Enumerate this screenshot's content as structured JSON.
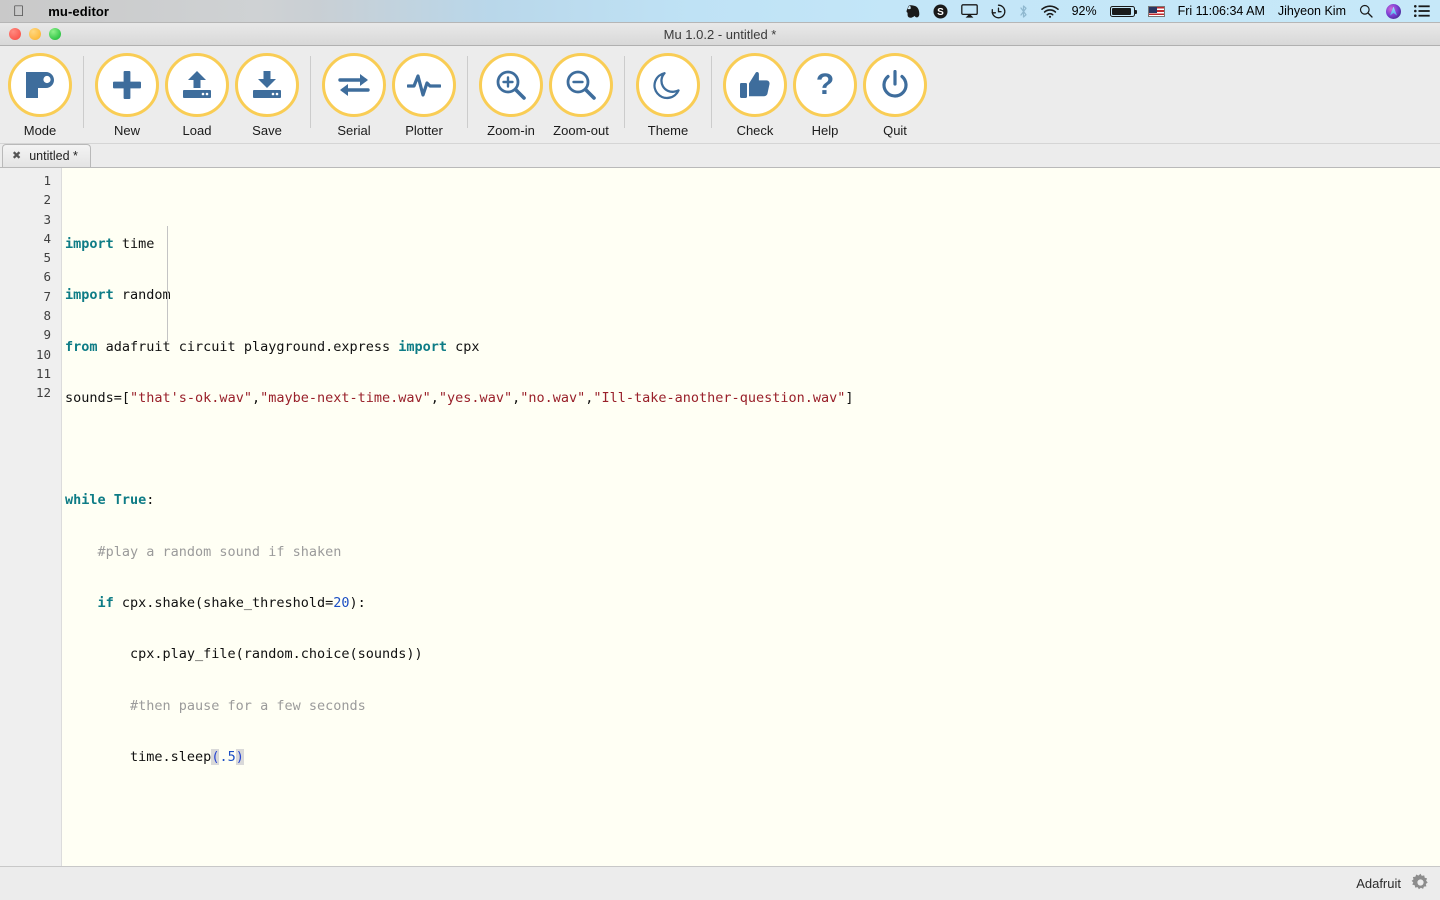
{
  "menubar": {
    "apple_icon": "apple-logo-icon",
    "app_name": "mu-editor",
    "status_items": [
      {
        "name": "evernote-icon",
        "label": ""
      },
      {
        "name": "skype-icon",
        "label": ""
      },
      {
        "name": "airplay-icon",
        "label": ""
      },
      {
        "name": "time-machine-icon",
        "label": ""
      },
      {
        "name": "bluetooth-icon",
        "label": ""
      },
      {
        "name": "wifi-icon",
        "label": ""
      }
    ],
    "battery_percent": "92%",
    "input_source": "us-flag-icon",
    "clock": "Fri 11:06:34 AM",
    "user_name": "Jihyeon Kim",
    "search_icon": "search-icon",
    "siri_icon": "siri-icon",
    "control_center_icon": "list-icon"
  },
  "window": {
    "title": "Mu 1.0.2 - untitled *",
    "traffic_lights": [
      "close-button",
      "minimize-button",
      "zoom-button"
    ],
    "colors": {
      "toolbar_accent": "#f9cd55",
      "icon_blue": "#3e6d9c",
      "editor_background": "#fffff4",
      "gutter_background": "#efefef"
    }
  },
  "toolbar": {
    "buttons": [
      {
        "label": "Mode",
        "icon": "mode-icon"
      },
      {
        "label": "New",
        "icon": "plus-icon"
      },
      {
        "label": "Load",
        "icon": "upload-icon"
      },
      {
        "label": "Save",
        "icon": "download-icon"
      },
      {
        "label": "Serial",
        "icon": "exchange-arrows-icon"
      },
      {
        "label": "Plotter",
        "icon": "waveform-icon"
      },
      {
        "label": "Zoom-in",
        "icon": "magnifier-plus-icon"
      },
      {
        "label": "Zoom-out",
        "icon": "magnifier-minus-icon"
      },
      {
        "label": "Theme",
        "icon": "moon-icon"
      },
      {
        "label": "Check",
        "icon": "thumbs-up-icon"
      },
      {
        "label": "Help",
        "icon": "question-mark-icon"
      },
      {
        "label": "Quit",
        "icon": "power-icon"
      }
    ]
  },
  "tabs": [
    {
      "label": "untitled *",
      "close_icon": "close-icon",
      "active": true
    }
  ],
  "editor": {
    "line_numbers": [
      "1",
      "2",
      "3",
      "4",
      "5",
      "6",
      "7",
      "8",
      "9",
      "10",
      "11",
      "12"
    ],
    "lines": [
      "import time",
      "import random",
      "from adafruit circuit playground.express import cpx",
      "sounds=[\"that's-ok.wav\",\"maybe-next-time.wav\",\"yes.wav\",\"no.wav\",\"Ill-take-another-question.wav\"]",
      "",
      "while True:",
      "    #play a random sound if shaken",
      "    if cpx.shake(shake_threshold=20):",
      "        cpx.play_file(random.choice(sounds))",
      "        #then pause for a few seconds",
      "        time.sleep(.5)",
      ""
    ]
  },
  "statusbar": {
    "mode_label": "Adafruit",
    "settings_icon": "gear-icon"
  }
}
